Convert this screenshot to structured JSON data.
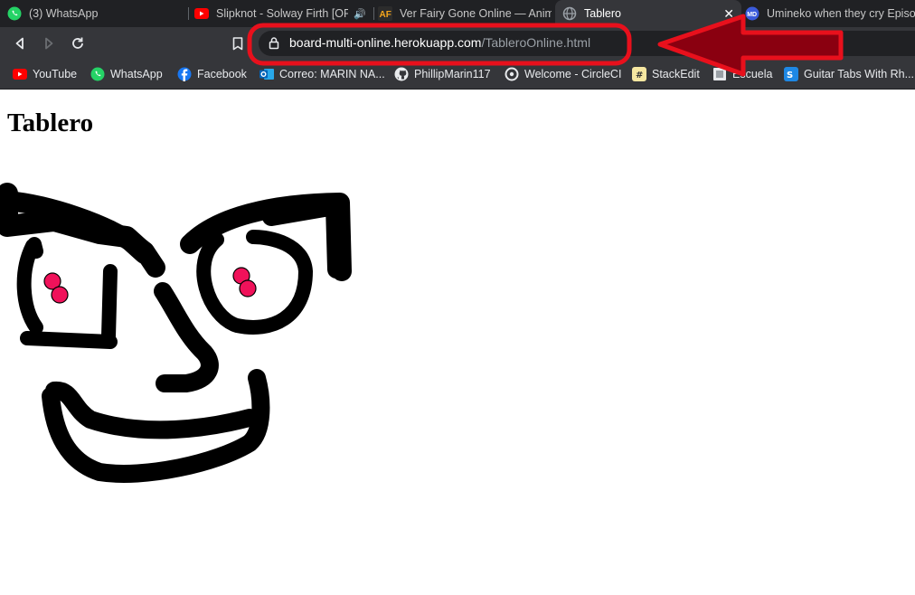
{
  "tabs": [
    {
      "title": "(3) WhatsApp",
      "icon": "whatsapp-icon"
    },
    {
      "title": "Slipknot - Solway Firth [OFFICIAL VIDEO]",
      "icon": "youtube-icon"
    },
    {
      "title": "Ver Fairy Gone Online — AnimeFLV",
      "icon": "animeflv-icon"
    },
    {
      "title": "Tablero",
      "icon": "globe-icon",
      "active": true
    },
    {
      "title": "Umineko when they cry Episode",
      "icon": "umineko-icon"
    }
  ],
  "omnibox": {
    "host": "board-multi-online.herokuapp.com",
    "path": "/TableroOnline.html"
  },
  "bookmarks": [
    {
      "label": "YouTube",
      "icon": "youtube-icon"
    },
    {
      "label": "WhatsApp",
      "icon": "whatsapp-icon"
    },
    {
      "label": "Facebook",
      "icon": "facebook-icon"
    },
    {
      "label": "Correo: MARIN NA...",
      "icon": "outlook-icon"
    },
    {
      "label": "PhillipMarin117",
      "icon": "github-icon"
    },
    {
      "label": "Welcome - CircleCI",
      "icon": "circleci-icon"
    },
    {
      "label": "StackEdit",
      "icon": "stackedit-icon"
    },
    {
      "label": "Escuela",
      "icon": "folder-icon"
    },
    {
      "label": "Guitar Tabs With Rh...",
      "icon": "guitar-tabs-icon"
    }
  ],
  "page": {
    "title": "Tablero"
  },
  "colors": {
    "tabstrip": "#202124",
    "toolbar": "#35363a",
    "annotation": "#e8101c",
    "ink": "#000000",
    "eyes": "#f0125a"
  }
}
